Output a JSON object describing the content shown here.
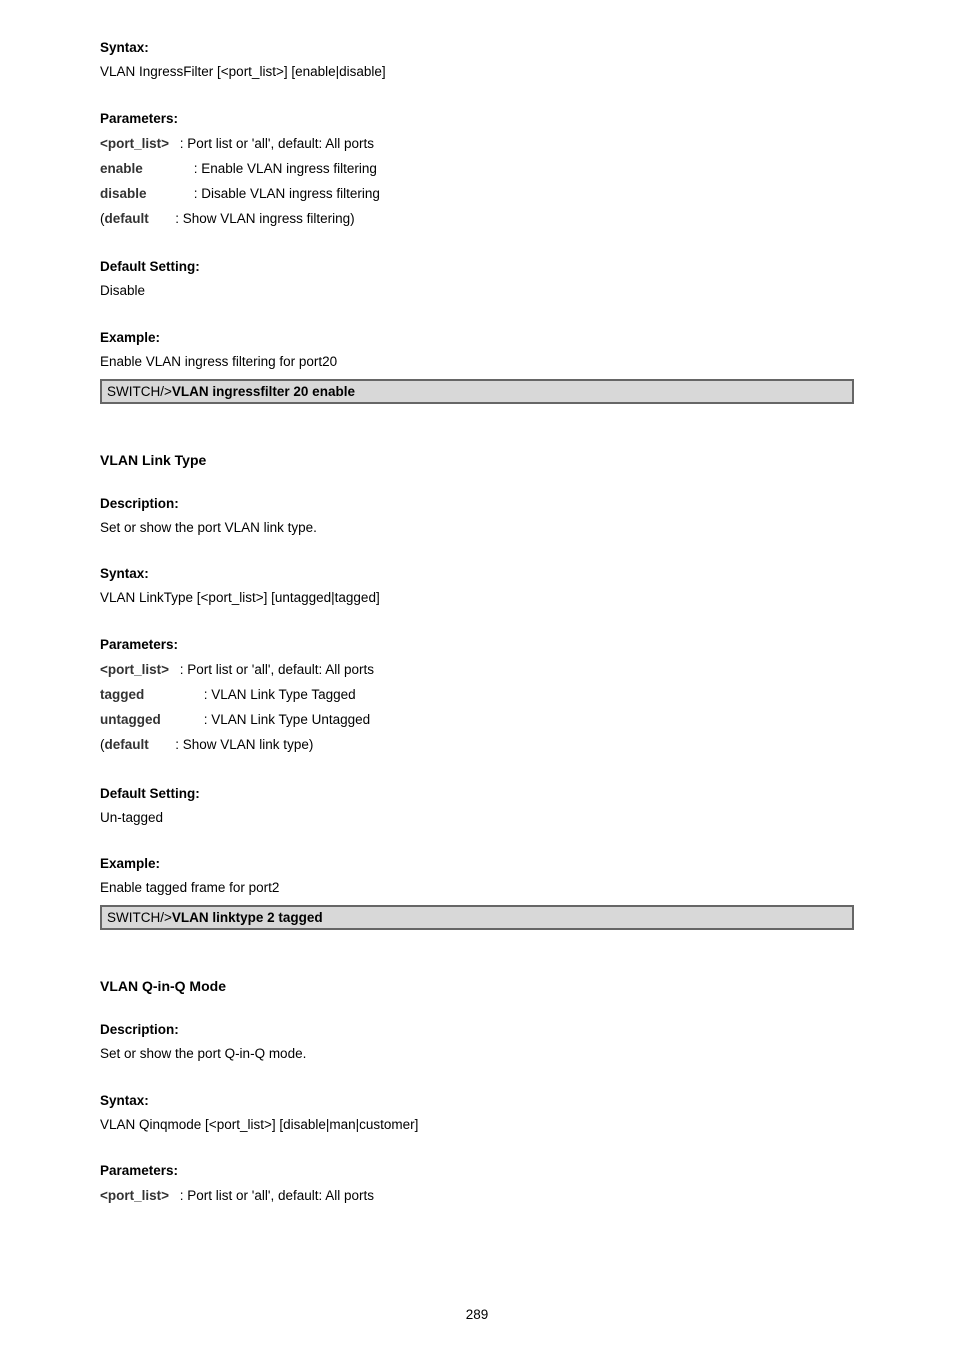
{
  "section1": {
    "labels": {
      "syntax": "Syntax:",
      "parameters": "Parameters:",
      "defaultSetting": "Default Setting:",
      "example": "Example:"
    },
    "syntaxText": "VLAN IngressFilter [<port_list>] [enable|disable]",
    "params": [
      {
        "label": "<port_list>",
        "desc": ": Port list or 'all', default: All ports"
      },
      {
        "label": "enable",
        "desc": ": Enable VLAN ingress filtering"
      },
      {
        "label": "disable",
        "desc": ": Disable VLAN ingress filtering"
      }
    ],
    "paramNote": {
      "open": "(",
      "label": "default",
      "desc": ": Show VLAN ingress filtering)"
    },
    "defaultValue": "Disable",
    "exampleText": "Enable VLAN ingress filtering for port20",
    "code": {
      "prompt": "SWITCH/>",
      "command": "VLAN ingressfilter 20 enable"
    }
  },
  "section2": {
    "heading": "VLAN Link Type",
    "labels": {
      "description": "Description:",
      "syntax": "Syntax:",
      "parameters": "Parameters:",
      "defaultSetting": "Default Setting:",
      "example": "Example:"
    },
    "descriptionText": "Set or show the port VLAN link type.",
    "syntaxText": "VLAN LinkType [<port_list>] [untagged|tagged]",
    "params": [
      {
        "label": "<port_list>",
        "desc": ": Port list or 'all', default: All ports"
      },
      {
        "label": "tagged",
        "desc": ": VLAN Link Type Tagged"
      },
      {
        "label": "untagged",
        "desc": ": VLAN Link Type Untagged"
      }
    ],
    "paramNote": {
      "open": "(",
      "label": "default",
      "desc": ": Show VLAN link type)"
    },
    "defaultValue": "Un-tagged",
    "exampleText": "Enable tagged frame for port2",
    "code": {
      "prompt": "SWITCH/>",
      "command": "VLAN linktype 2 tagged"
    }
  },
  "section3": {
    "heading": "VLAN Q-in-Q Mode",
    "labels": {
      "description": "Description:",
      "syntax": "Syntax:",
      "parameters": "Parameters:"
    },
    "descriptionText": "Set or show the port Q-in-Q mode.",
    "syntaxText": "VLAN Qinqmode [<port_list>] [disable|man|customer]",
    "params": [
      {
        "label": "<port_list>",
        "desc": ": Port list or 'all', default: All ports"
      }
    ]
  },
  "pageNumber": "289"
}
